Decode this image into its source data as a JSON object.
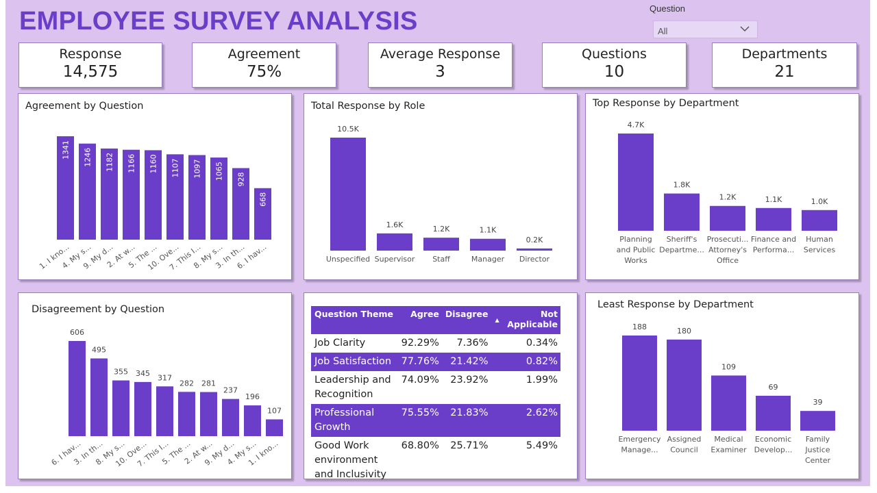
{
  "header": {
    "title": "EMPLOYEE SURVEY ANALYSIS",
    "slicer_label": "Question",
    "slicer_value": "All"
  },
  "kpis": [
    {
      "label": "Response",
      "value": "14,575"
    },
    {
      "label": "Agreement",
      "value": "75%"
    },
    {
      "label": "Average Response",
      "value": "3"
    },
    {
      "label": "Questions",
      "value": "10"
    },
    {
      "label": "Departments",
      "value": "21"
    }
  ],
  "colors": {
    "accent": "#6b3ec9",
    "background": "#dcc3ef"
  },
  "table": {
    "headers": [
      "Question Theme",
      "Agree",
      "Disagree",
      "Not Applicable"
    ],
    "rows": [
      [
        "Job Clarity",
        "92.29%",
        "7.36%",
        "0.34%"
      ],
      [
        "Job Satisfaction",
        "77.76%",
        "21.42%",
        "0.82%"
      ],
      [
        "Leadership and Recognition",
        "74.09%",
        "23.92%",
        "1.99%"
      ],
      [
        "Professional Growth",
        "75.55%",
        "21.83%",
        "2.62%"
      ],
      [
        "Good Work environment and Inclusivity",
        "68.80%",
        "25.71%",
        "5.49%"
      ]
    ]
  },
  "chart_data": [
    {
      "id": "agree",
      "type": "bar",
      "title": "Agreement by Question",
      "categories": [
        "1. I kno...",
        "4. My s...",
        "9. My d...",
        "2. At w...",
        "5. The ...",
        "10. Ove...",
        "7. This I...",
        "8. My s...",
        "3. In th...",
        "6. I hav..."
      ],
      "values": [
        1341,
        1246,
        1182,
        1166,
        1160,
        1107,
        1097,
        1065,
        928,
        668
      ],
      "labels": [
        "1341",
        "1246",
        "1182",
        "1166",
        "1160",
        "1107",
        "1097",
        "1065",
        "928",
        "668"
      ],
      "ylim": [
        0,
        1341
      ],
      "label_position": "inside-rotated",
      "x_label_rotation": "diagonal"
    },
    {
      "id": "role",
      "type": "bar",
      "title": "Total Response by Role",
      "categories": [
        "Unspecified",
        "Supervisor",
        "Staff",
        "Manager",
        "Director"
      ],
      "values": [
        10500,
        1600,
        1200,
        1100,
        200
      ],
      "labels": [
        "10.5K",
        "1.6K",
        "1.2K",
        "1.1K",
        "0.2K"
      ],
      "ylim": [
        0,
        10500
      ],
      "label_position": "above"
    },
    {
      "id": "topdept",
      "type": "bar",
      "title": "Top Response by Department",
      "categories": [
        "Planning and Public Works",
        "Sheriff's Departme...",
        "Prosecuti... Attorney's Office",
        "Finance and Performa...",
        "Human Services"
      ],
      "values": [
        4700,
        1800,
        1200,
        1100,
        1000
      ],
      "labels": [
        "4.7K",
        "1.8K",
        "1.2K",
        "1.1K",
        "1.0K"
      ],
      "ylim": [
        0,
        4700
      ],
      "label_position": "above"
    },
    {
      "id": "disagree",
      "type": "bar",
      "title": "Disagreement by Question",
      "categories": [
        "6. I hav...",
        "3. In th...",
        "8. My s...",
        "10. Ove...",
        "7. This I...",
        "5. The ...",
        "2. At w...",
        "9. My d...",
        "4. My s...",
        "1. I kno..."
      ],
      "values": [
        606,
        495,
        355,
        345,
        317,
        282,
        281,
        237,
        196,
        107
      ],
      "labels": [
        "606",
        "495",
        "355",
        "345",
        "317",
        "282",
        "281",
        "237",
        "196",
        "107"
      ],
      "ylim": [
        0,
        606
      ],
      "label_position": "above",
      "x_label_rotation": "diagonal"
    },
    {
      "id": "leastdept",
      "type": "bar",
      "title": "Least Response by Department",
      "categories": [
        "Emergency Manage...",
        "Assigned Council",
        "Medical Examiner",
        "Economic Develop...",
        "Family Justice Center"
      ],
      "values": [
        188,
        180,
        109,
        69,
        39
      ],
      "labels": [
        "188",
        "180",
        "109",
        "69",
        "39"
      ],
      "ylim": [
        0,
        188
      ],
      "label_position": "above"
    }
  ]
}
